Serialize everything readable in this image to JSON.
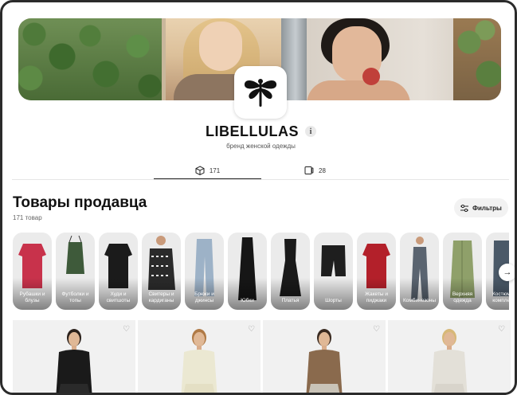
{
  "brand": {
    "name": "LIBELLULAS",
    "subtitle": "бренд женской одежды",
    "info_icon": "info-icon",
    "logo_icon": "dragonfly-logo"
  },
  "tabs": [
    {
      "icon": "box-icon",
      "count": "171",
      "active": true
    },
    {
      "icon": "video-icon",
      "count": "28",
      "active": false
    }
  ],
  "section": {
    "title": "Товары продавца",
    "count": "171 товар",
    "filter_label": "Фильтры",
    "filter_icon": "sliders-icon"
  },
  "categories": [
    {
      "label": "Рубашки и блузы",
      "color": "#c8324b"
    },
    {
      "label": "Футболки и топы",
      "color": "#3e5a3a"
    },
    {
      "label": "Худи и свитшоты",
      "color": "#1b1b1b"
    },
    {
      "label": "Свитеры и кардиганы",
      "color": "#2a2a2a"
    },
    {
      "label": "Брюки и джинсы",
      "color": "#9db2c7"
    },
    {
      "label": "Юбки",
      "color": "#161616"
    },
    {
      "label": "Платья",
      "color": "#1a1a1a"
    },
    {
      "label": "Шорты",
      "color": "#1e1e1e"
    },
    {
      "label": "Жакеты и пиджаки",
      "color": "#b3202a"
    },
    {
      "label": "Комбинезоны",
      "color": "#5a6470"
    },
    {
      "label": "Верхняя одежда",
      "color": "#8fa06a"
    },
    {
      "label": "Костюмы и комплекты",
      "color": "#4a5968"
    }
  ],
  "next_icon": "chevron-right-icon",
  "products": [
    {
      "top": "#1a1a1a",
      "bottom": "#2a2a2a",
      "hair": "#2b211b"
    },
    {
      "top": "#ebe8d2",
      "bottom": "#e4dfc4",
      "hair": "#b07a46"
    },
    {
      "top": "#8a6a4d",
      "bottom": "#c9c3b7",
      "hair": "#3a2a20"
    },
    {
      "top": "#e3e0d8",
      "bottom": "#d8d4cb",
      "hair": "#d7b878"
    }
  ],
  "heart_icon": "heart-icon",
  "colors": {
    "frame": "#2b2b2b",
    "accent": "#111111"
  }
}
